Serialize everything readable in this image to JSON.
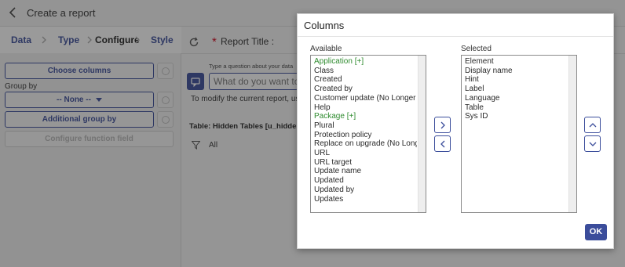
{
  "page": {
    "title": "Create a report",
    "steps": [
      "Data",
      "Type",
      "Configure",
      "Style"
    ],
    "active_step": "Configure",
    "left_panel": {
      "choose_columns": "Choose columns",
      "group_by_label": "Group by",
      "group_by_value": "-- None --",
      "additional_group_by": "Additional group by",
      "configure_function_field": "Configure function field"
    },
    "report_title_label": "Report Title :",
    "ask_label": "Type a question about your data",
    "ask_placeholder": "What do you want to se",
    "modify_text": "To modify the current report, use",
    "table_label": "Table: Hidden Tables [u_hidden_ta",
    "filter_all": "All"
  },
  "modal": {
    "title": "Columns",
    "available_label": "Available",
    "selected_label": "Selected",
    "available_items": [
      {
        "text": "Application [+]",
        "group": true
      },
      {
        "text": "Class",
        "group": false
      },
      {
        "text": "Created",
        "group": false
      },
      {
        "text": "Created by",
        "group": false
      },
      {
        "text": "Customer update (No Longer Us",
        "group": false
      },
      {
        "text": "Help",
        "group": false
      },
      {
        "text": "Package [+]",
        "group": true
      },
      {
        "text": "Plural",
        "group": false
      },
      {
        "text": "Protection policy",
        "group": false
      },
      {
        "text": "Replace on upgrade (No Longer U",
        "group": false
      },
      {
        "text": "URL",
        "group": false
      },
      {
        "text": "URL target",
        "group": false
      },
      {
        "text": "Update name",
        "group": false
      },
      {
        "text": "Updated",
        "group": false
      },
      {
        "text": "Updated by",
        "group": false
      },
      {
        "text": "Updates",
        "group": false
      }
    ],
    "selected_items": [
      "Element",
      "Display name",
      "Hint",
      "Label",
      "Language",
      "Table",
      "Sys ID"
    ],
    "ok_label": "OK"
  },
  "colors": {
    "accent": "#3b4d9b",
    "group_item": "#2e8b2e",
    "required": "#d0021b"
  },
  "icons": [
    "back-chevron-icon",
    "step-chevron-icon",
    "refresh-icon",
    "info-icon",
    "chat-icon",
    "filter-icon",
    "arrow-right-icon",
    "arrow-left-icon",
    "arrow-up-icon",
    "arrow-down-icon"
  ]
}
